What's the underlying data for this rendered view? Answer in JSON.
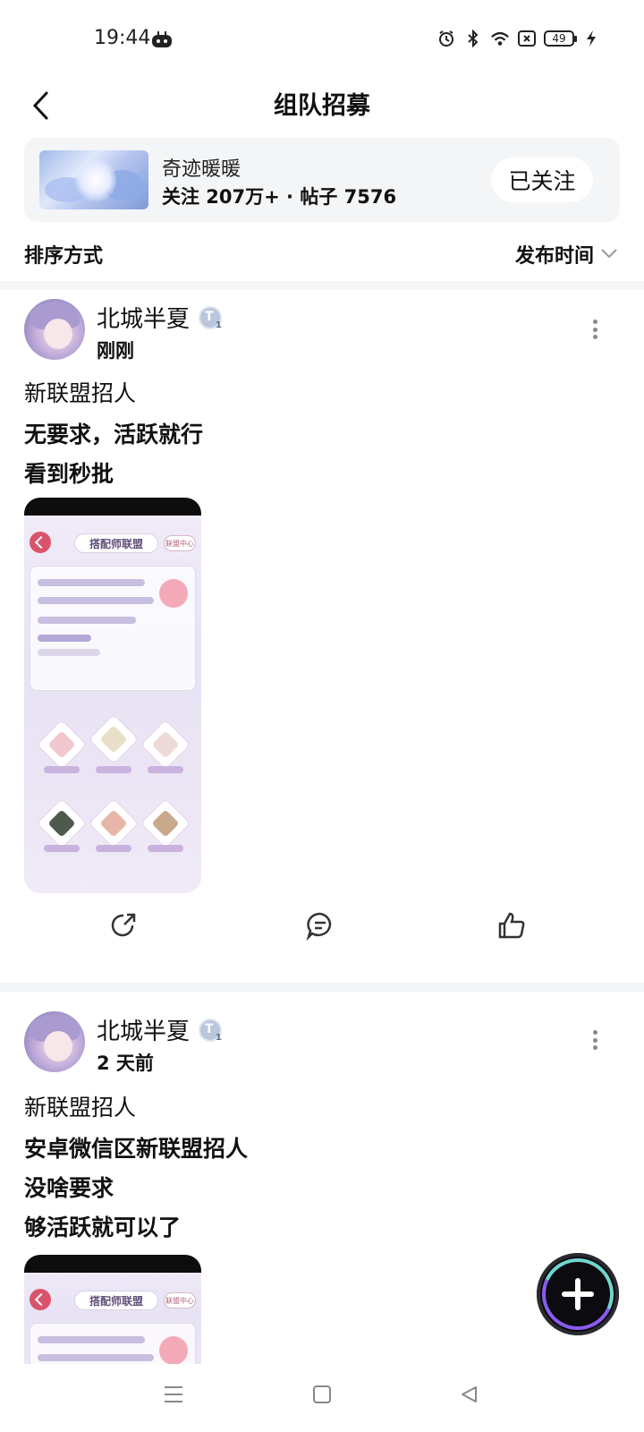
{
  "status_bar": {
    "time": "19:44",
    "battery_level": "49",
    "icons": [
      "app-icon",
      "alarm-icon",
      "bluetooth-icon",
      "wifi-icon",
      "no-sim-icon",
      "battery-icon",
      "charging-icon"
    ]
  },
  "header": {
    "title": "组队招募",
    "back_icon": "chevron-left-icon"
  },
  "forum": {
    "name": "奇迹暖暖",
    "stats": "关注 207万+ · 帖子 7576",
    "follow_label": "已关注"
  },
  "sort": {
    "label": "排序方式",
    "value": "发布时间",
    "chevron_icon": "chevron-down-icon"
  },
  "posts": [
    {
      "author": "北城半夏",
      "level_badge_letter": "T",
      "level_badge_num": "1",
      "time": "刚刚",
      "lines": [
        "新联盟招人",
        "无要求，活跃就行",
        "看到秒批"
      ],
      "image": {
        "title": "搭配师联盟",
        "tag": "联盟中心"
      }
    },
    {
      "author": "北城半夏",
      "level_badge_letter": "T",
      "level_badge_num": "1",
      "time": "2 天前",
      "lines": [
        "新联盟招人",
        "安卓微信区新联盟招人",
        "没啥要求",
        "够活跃就可以了"
      ],
      "image": {
        "title": "搭配师联盟",
        "tag": "联盟中心"
      }
    }
  ],
  "actions": [
    "share-icon",
    "comment-icon",
    "like-icon"
  ],
  "fab": {
    "icon": "plus-icon"
  },
  "nav": [
    "menu-icon",
    "home-square-icon",
    "back-triangle-icon"
  ],
  "colors": {
    "card_bg": "#f3f5f7",
    "fab_bg": "#0c0b10",
    "fab_ring_teal": "#6fd7d0",
    "fab_ring_purple": "#8a5cf0"
  }
}
